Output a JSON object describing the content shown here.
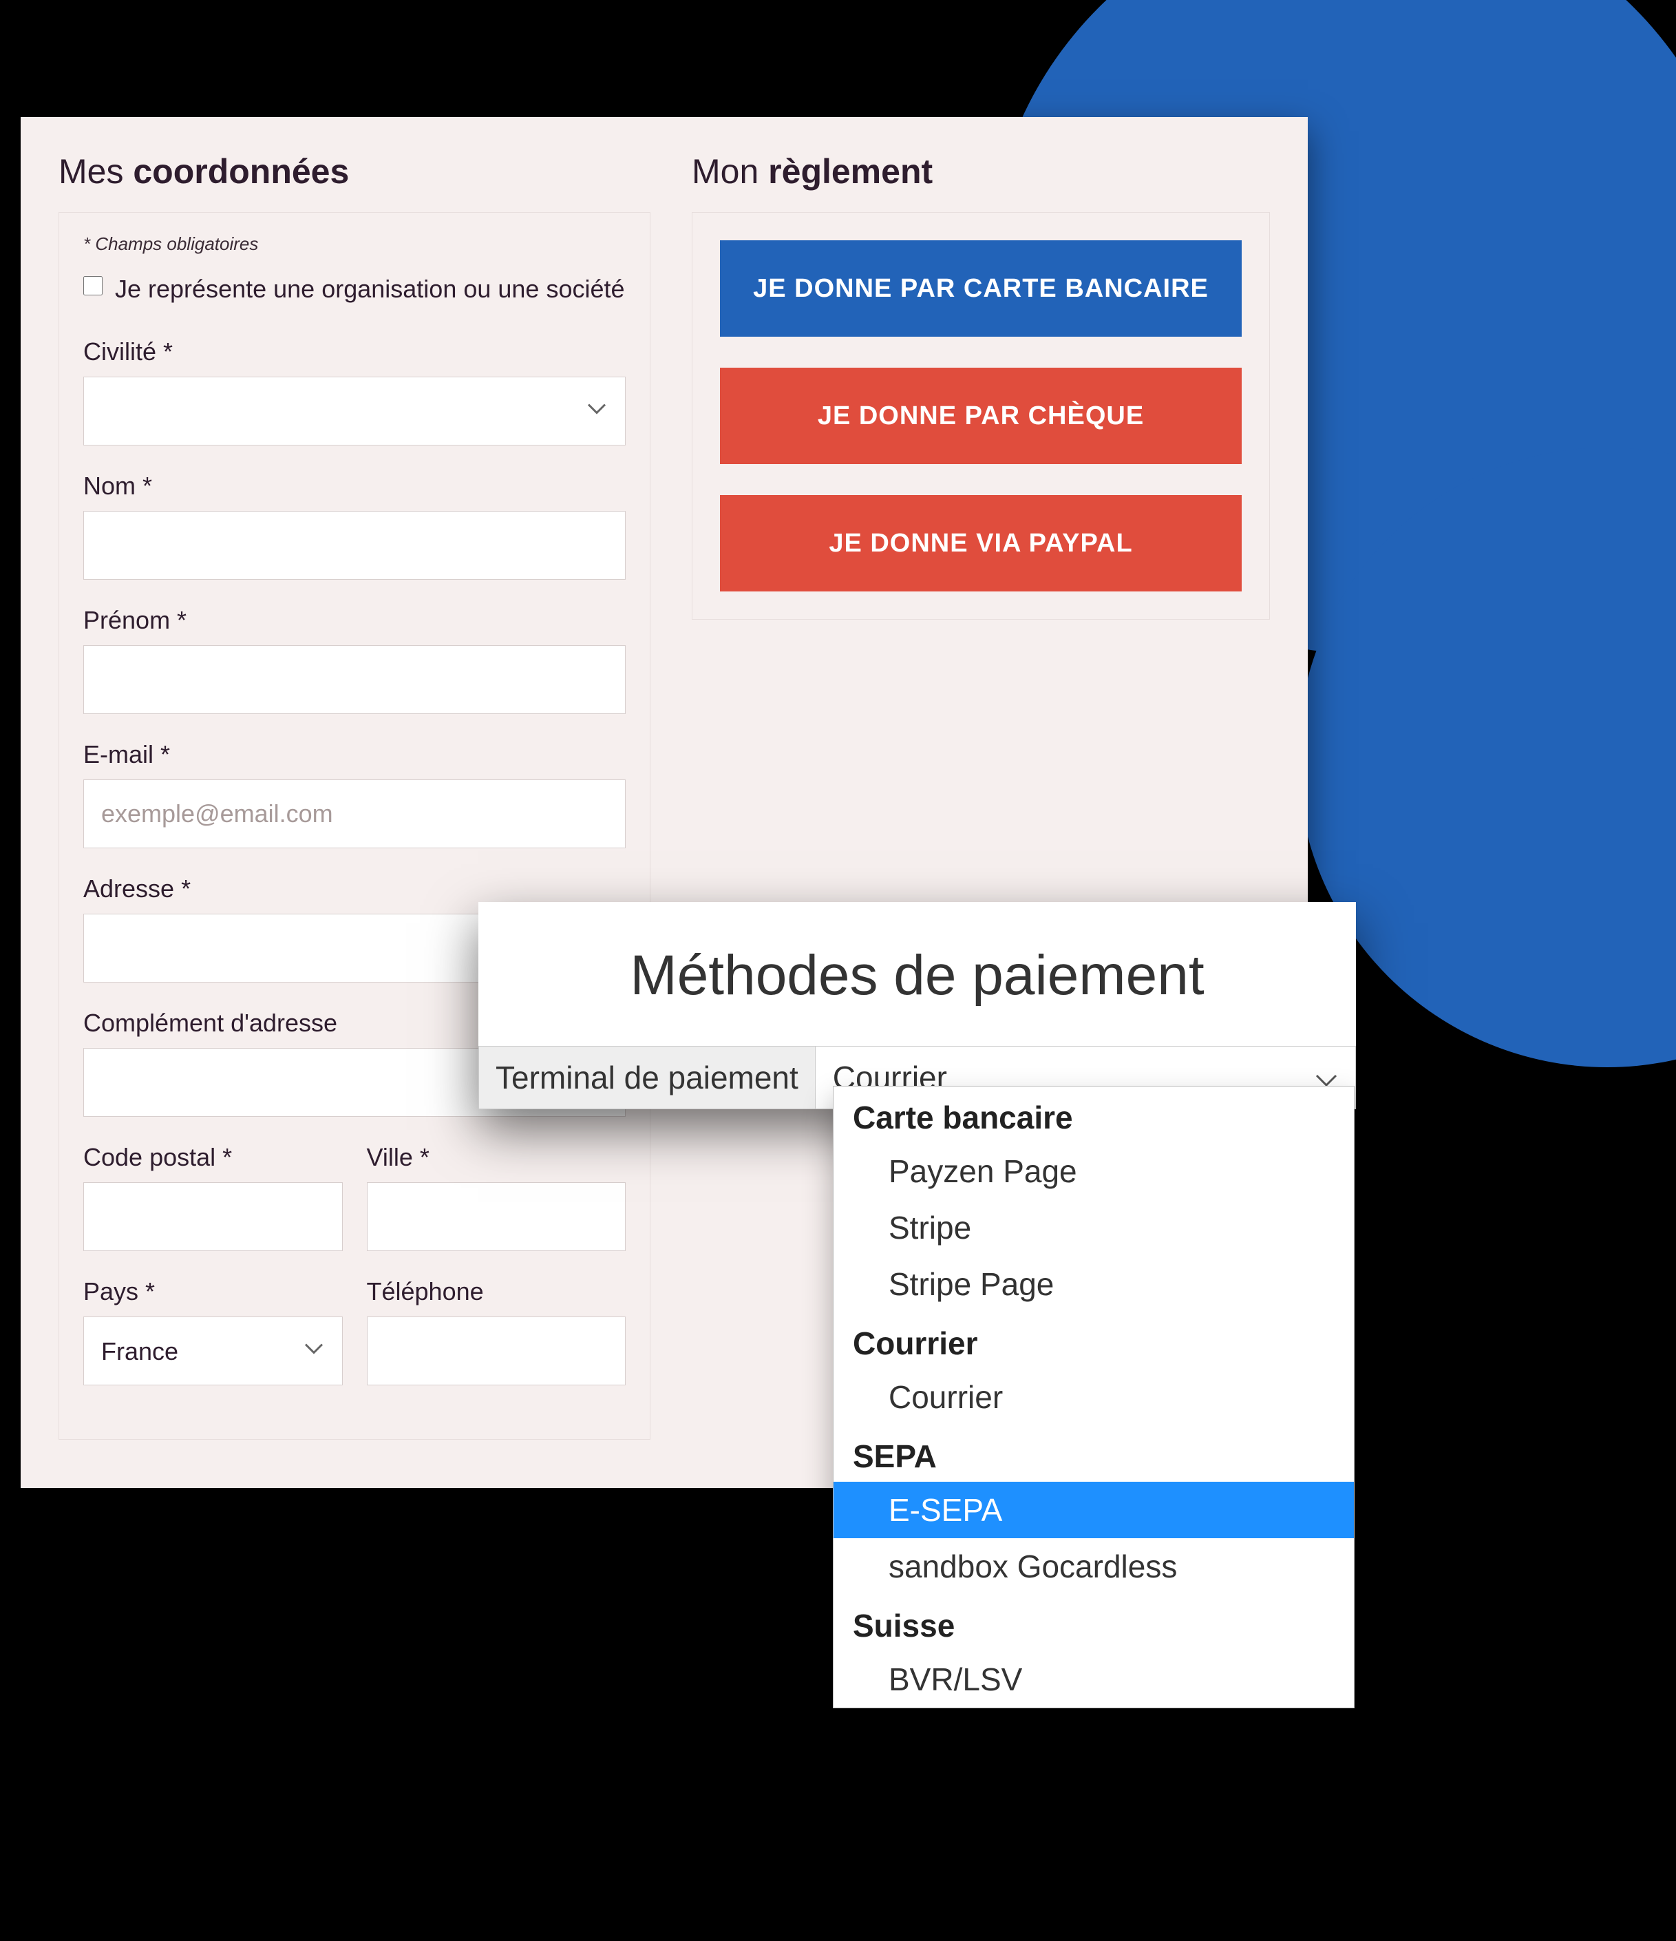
{
  "details": {
    "title_light": "Mes ",
    "title_bold": "coordonnées",
    "required_note": "* Champs obligatoires",
    "org_label": "Je représente une organisation ou une société",
    "civility_label": "Civilité *",
    "lastname_label": "Nom *",
    "firstname_label": "Prénom *",
    "email_label": "E-mail *",
    "email_placeholder": "exemple@email.com",
    "address_label": "Adresse *",
    "address2_label": "Complément d'adresse",
    "postal_label": "Code postal *",
    "city_label": "Ville *",
    "country_label": "Pays *",
    "country_value": "France",
    "phone_label": "Téléphone"
  },
  "payment": {
    "title_light": "Mon ",
    "title_bold": "règlement",
    "cb_label": "JE DONNE PAR CARTE BANCAIRE",
    "cheque_label": "JE DONNE PAR CHÈQUE",
    "paypal_label": "JE DONNE VIA PAYPAL"
  },
  "modal": {
    "title": "Méthodes de paiement",
    "terminal_label": "Terminal de paiement",
    "terminal_value": "Courrier",
    "groups": [
      {
        "name": "Carte bancaire",
        "items": [
          "Payzen Page",
          "Stripe",
          "Stripe Page"
        ]
      },
      {
        "name": "Courrier",
        "items": [
          "Courrier"
        ]
      },
      {
        "name": "SEPA",
        "items": [
          "E-SEPA",
          "sandbox Gocardless"
        ]
      },
      {
        "name": "Suisse",
        "items": [
          "BVR/LSV"
        ]
      }
    ],
    "selected": "E-SEPA"
  }
}
